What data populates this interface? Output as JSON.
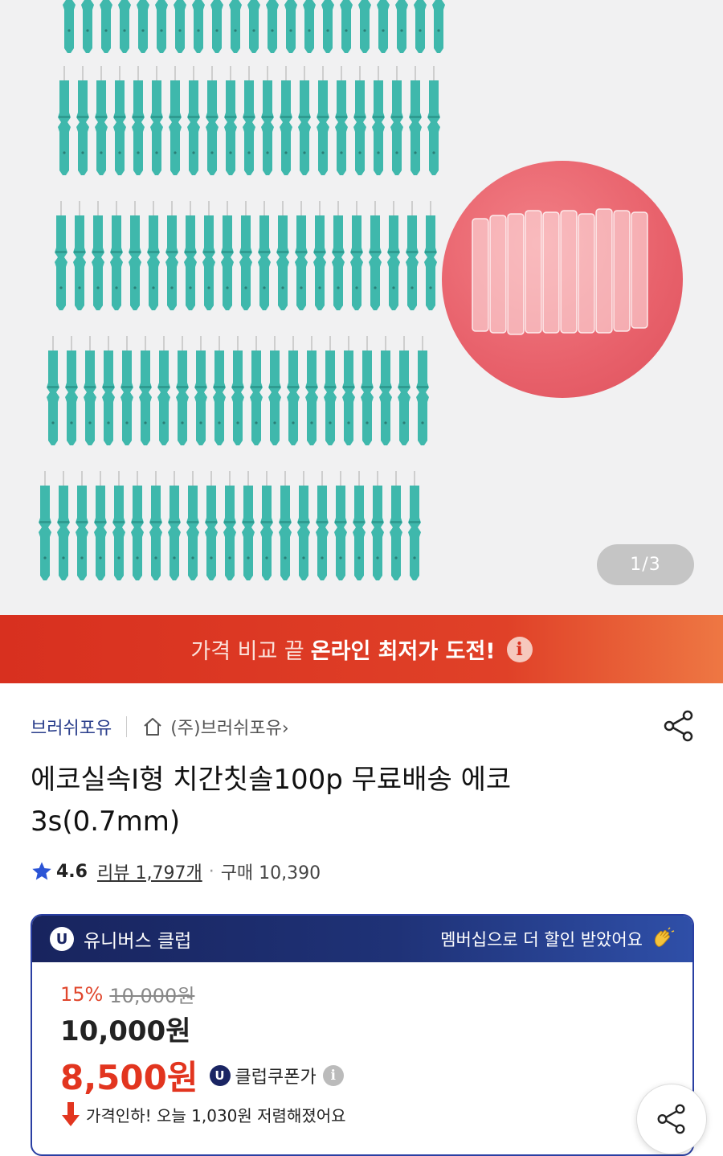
{
  "gallery": {
    "counter": "1/3"
  },
  "promo_banner": {
    "prefix": "가격 비교 끝",
    "highlight": "온라인 최저가 도전!",
    "info_icon": "i"
  },
  "seller": {
    "brand": "브러쉬포유",
    "store": "(주)브러쉬포유",
    "store_chevron": "›"
  },
  "product": {
    "title": "에코실속I형 치간칫솔100p 무료배송 에코 3s(0.7mm)"
  },
  "rating": {
    "score": "4.6",
    "reviews": "리뷰 1,797개",
    "separator": "·",
    "purchases": "구매 10,390"
  },
  "club": {
    "badge": "U",
    "name": "유니버스 클럽",
    "message": "멤버십으로 더 할인 받았어요",
    "discount_percent": "15%",
    "original_price": "10,000원",
    "price": "10,000원",
    "club_price": "8,500원",
    "coupon_label": "클럽쿠폰가",
    "info_icon": "i",
    "price_drop": "가격인하! 오늘 1,030원 저렴해졌어요"
  },
  "colors": {
    "brand_blue": "#2b3f8c",
    "club_navy": "#1a2563",
    "sale_red": "#e2351f",
    "banner_red": "#d8301f",
    "brush_teal": "#3fb8ac"
  },
  "icons": [
    "home-icon",
    "share-icon",
    "star-icon",
    "info-icon",
    "clap-icon",
    "price-down-icon"
  ]
}
